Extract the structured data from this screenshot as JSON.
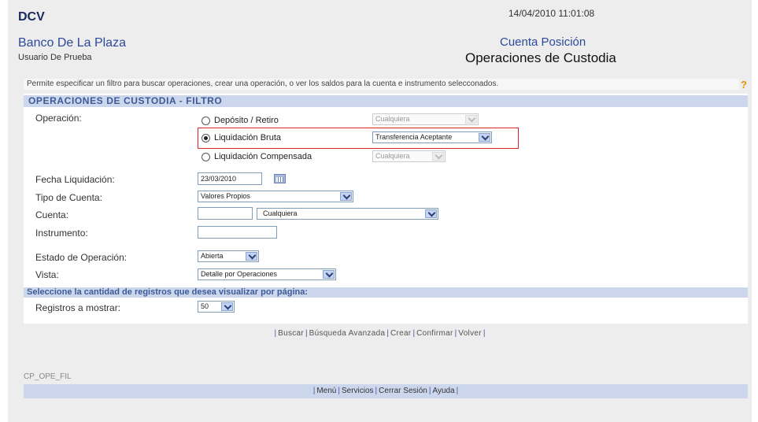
{
  "header": {
    "app": "DCV",
    "bank": "Banco De La Plaza",
    "user": "Usuario De Prueba",
    "datetime": "14/04/2010 11:01:08",
    "section": "Cuenta Posición",
    "page_title": "Operaciones de Custodia"
  },
  "help_text": "Permite especificar un filtro para buscar operaciones, crear una operación, o ver los saldos para la cuenta e instrumento selecconados.",
  "help_icon": "?",
  "filter": {
    "title": "OPERACIONES DE CUSTODIA - FILTRO",
    "operacion_label": "Operación:",
    "options": [
      {
        "label": "Depósito / Retiro",
        "selected": false,
        "select_value": "Cualquiera",
        "enabled": false
      },
      {
        "label": "Liquidación Bruta",
        "selected": true,
        "select_value": "Transferencia Aceptante",
        "enabled": true
      },
      {
        "label": "Liquidación Compensada",
        "selected": false,
        "select_value": "Cualquiera",
        "enabled": false
      }
    ],
    "fecha_label": "Fecha Liquidación:",
    "fecha_value": "23/03/2010",
    "tipo_cuenta_label": "Tipo de Cuenta:",
    "tipo_cuenta_value": "Valores Propios",
    "cuenta_label": "Cuenta:",
    "cuenta_value": "",
    "cuenta_select": "Cualquiera",
    "instrumento_label": "Instrumento:",
    "instrumento_value": "",
    "estado_label": "Estado de Operación:",
    "estado_value": "Abierta",
    "vista_label": "Vista:",
    "vista_value": "Detalle por Operaciones"
  },
  "records": {
    "title": "Seleccione la cantidad de registros que desea visualizar por página:",
    "label": "Registros a mostrar:",
    "value": "50"
  },
  "actions": [
    "Buscar",
    "Búsqueda Avanzada",
    "Crear",
    "Confirmar",
    "Volver"
  ],
  "screen_code": "CP_OPE_FIL",
  "footer_links": [
    "Menú",
    "Servicios",
    "Cerrar Sesión",
    "Ayuda"
  ]
}
